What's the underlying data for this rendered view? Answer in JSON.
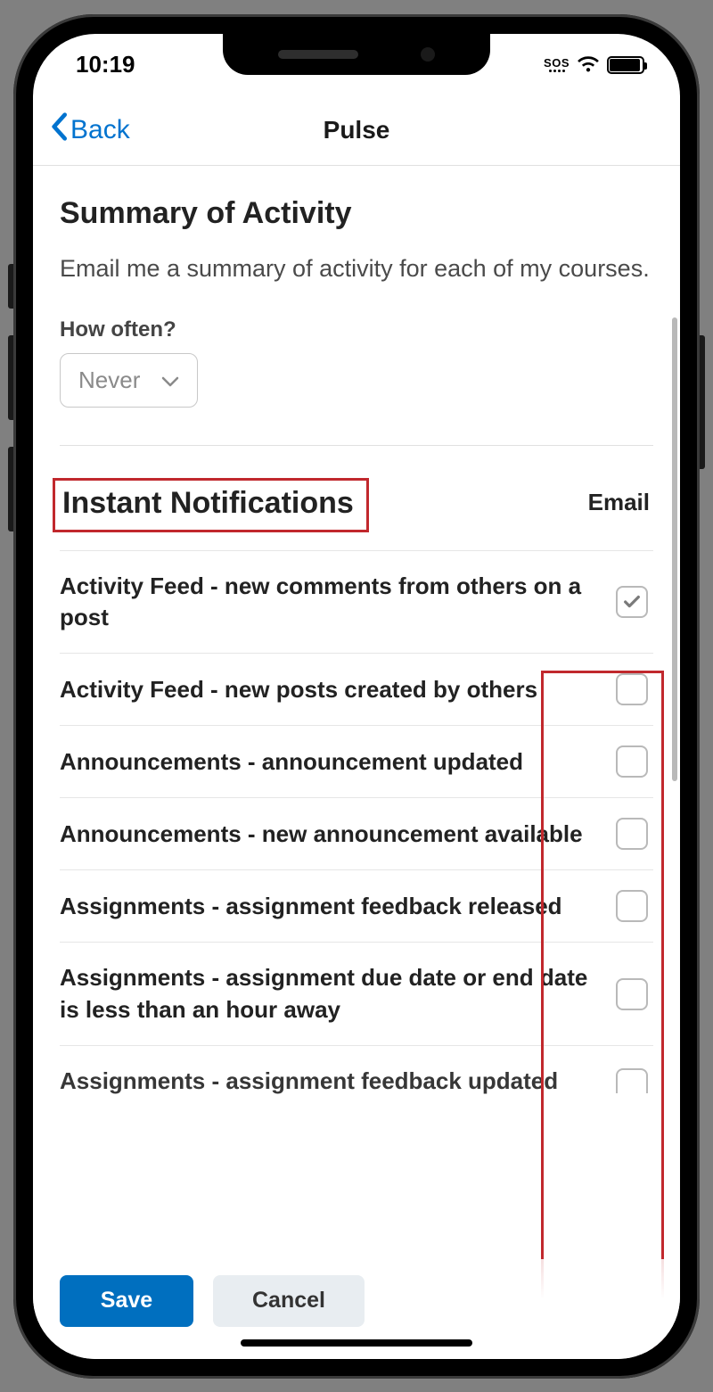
{
  "status": {
    "time": "10:19",
    "sos": "SOS"
  },
  "nav": {
    "back": "Back",
    "title": "Pulse"
  },
  "summary": {
    "heading": "Summary of Activity",
    "description": "Email me a summary of activity for each of my courses.",
    "frequency_label": "How often?",
    "frequency_value": "Never"
  },
  "instant": {
    "heading": "Instant Notifications",
    "column_header": "Email",
    "items": [
      {
        "label": "Activity Feed - new comments from others on a post",
        "checked": true
      },
      {
        "label": "Activity Feed - new posts created by others",
        "checked": false
      },
      {
        "label": "Announcements - announcement updated",
        "checked": false
      },
      {
        "label": "Announcements - new announcement available",
        "checked": false
      },
      {
        "label": "Assignments - assignment feedback released",
        "checked": false
      },
      {
        "label": "Assignments - assignment due date or end date is less than an hour away",
        "checked": false
      },
      {
        "label": "Assignments - assignment feedback updated",
        "checked": false
      }
    ]
  },
  "actions": {
    "save": "Save",
    "cancel": "Cancel"
  }
}
